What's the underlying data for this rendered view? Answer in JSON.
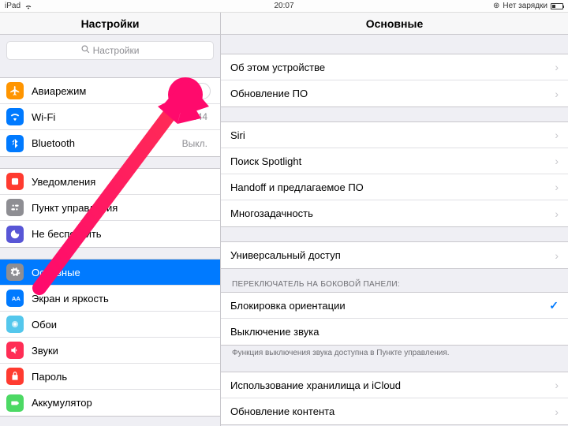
{
  "status": {
    "device": "iPad",
    "time": "20:07",
    "charge_text": "Нет зарядки"
  },
  "titles": {
    "left": "Настройки",
    "right": "Основные"
  },
  "search": {
    "placeholder": "Настройки"
  },
  "sidebar": {
    "g1": {
      "airplane": "Авиарежим",
      "wifi": "Wi-Fi",
      "wifi_value": "b444",
      "bluetooth": "Bluetooth",
      "bluetooth_value": "Выкл."
    },
    "g2": {
      "notifications": "Уведомления",
      "control_center": "Пункт управления",
      "dnd": "Не беспокоить"
    },
    "g3": {
      "general": "Основные",
      "display": "Экран и яркость",
      "wallpaper": "Обои",
      "sounds": "Звуки",
      "passcode": "Пароль",
      "battery": "Аккумулятор"
    }
  },
  "detail": {
    "g1": {
      "about": "Об этом устройстве",
      "update": "Обновление ПО"
    },
    "g2": {
      "siri": "Siri",
      "spotlight": "Поиск Spotlight",
      "handoff": "Handoff и предлагаемое ПО",
      "multitask": "Многозадачность"
    },
    "g3": {
      "accessibility": "Универсальный доступ"
    },
    "side_switch_header": "ПЕРЕКЛЮЧАТЕЛЬ НА БОКОВОЙ ПАНЕЛИ:",
    "g4": {
      "lock_rotation": "Блокировка ориентации",
      "mute": "Выключение звука"
    },
    "side_switch_footer": "Функция выключения звука доступна в Пункте управления.",
    "g5": {
      "storage": "Использование хранилища и iCloud",
      "bg_refresh": "Обновление контента"
    }
  }
}
